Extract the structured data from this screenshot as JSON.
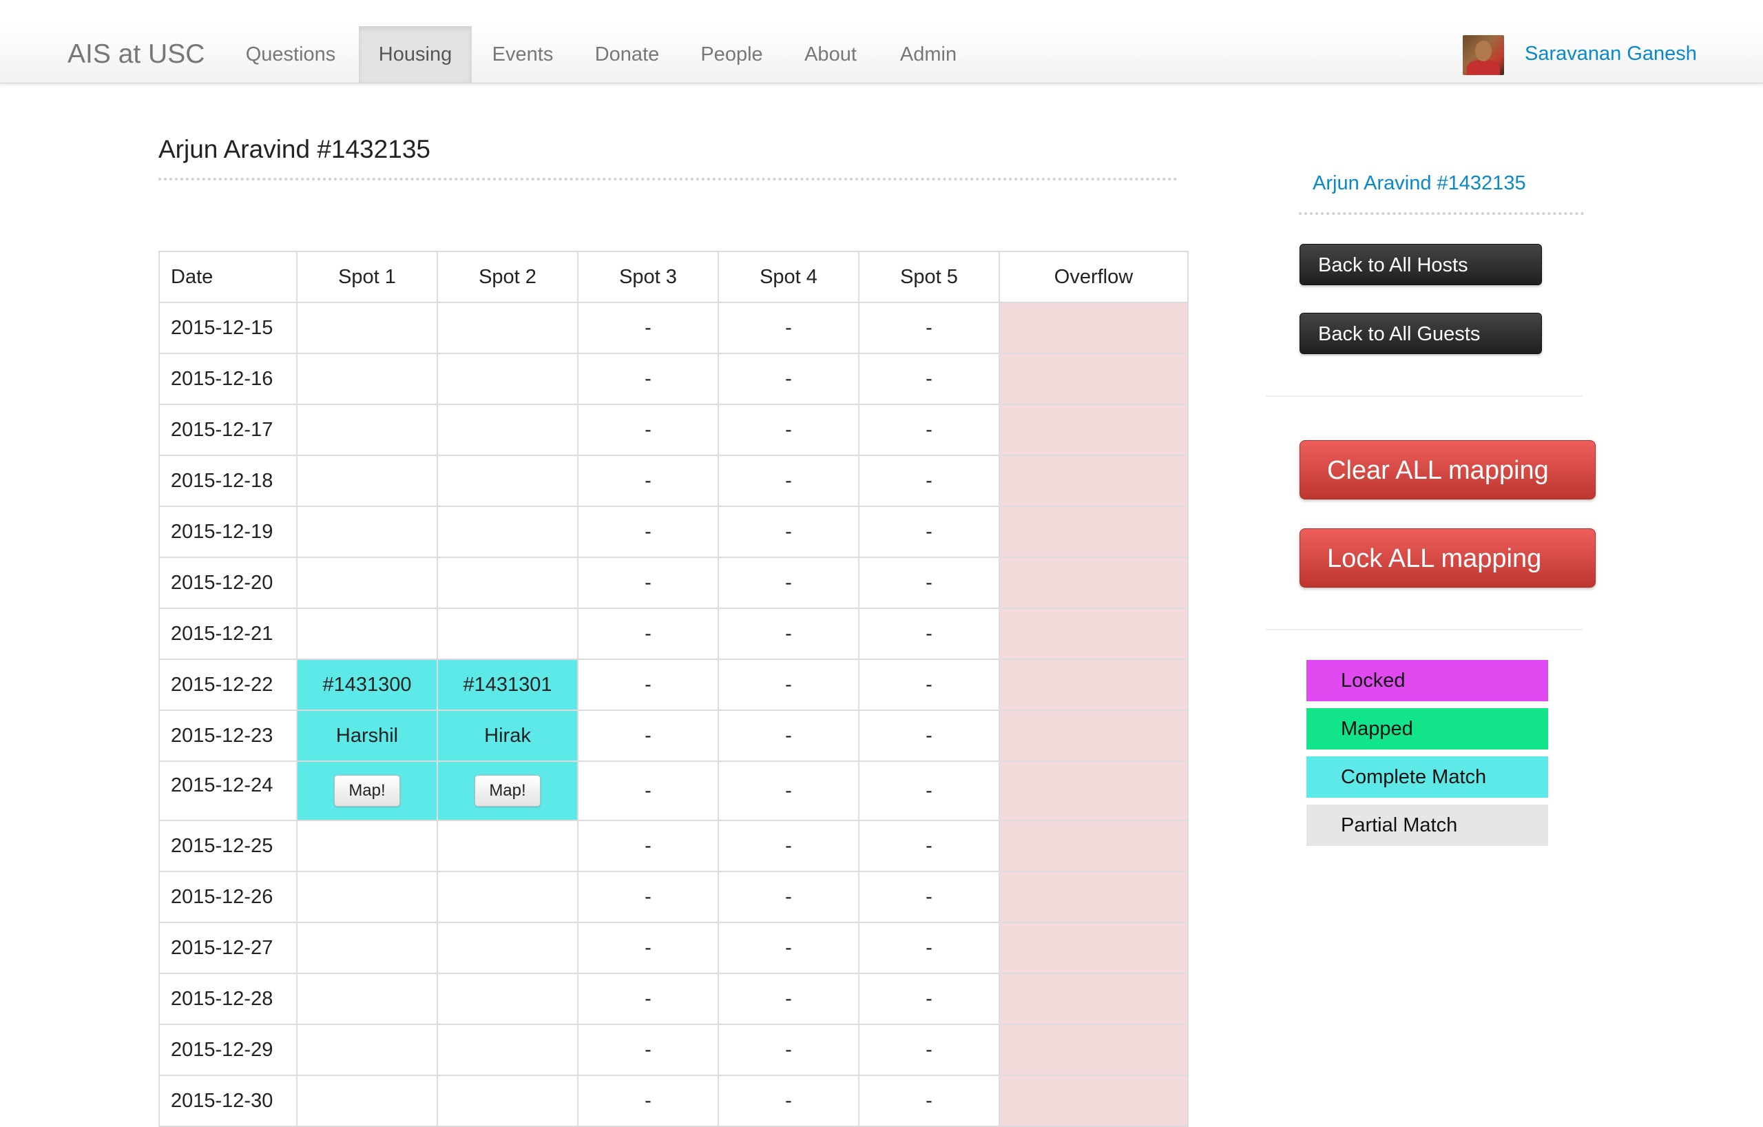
{
  "nav": {
    "brand": "AIS at USC",
    "items": [
      {
        "label": "Questions"
      },
      {
        "label": "Housing",
        "active": true
      },
      {
        "label": "Events"
      },
      {
        "label": "Donate"
      },
      {
        "label": "People"
      },
      {
        "label": "About"
      },
      {
        "label": "Admin"
      }
    ],
    "user_name": "Saravanan Ganesh"
  },
  "main": {
    "title": "Arjun Aravind #1432135",
    "table": {
      "headers": [
        "Date",
        "Spot 1",
        "Spot 2",
        "Spot 3",
        "Spot 4",
        "Spot 5",
        "Overflow"
      ],
      "rows": [
        {
          "date": "2015-12-15",
          "spot1": "",
          "spot2": "",
          "spot3": "-",
          "spot4": "-",
          "spot5": "-"
        },
        {
          "date": "2015-12-16",
          "spot1": "",
          "spot2": "",
          "spot3": "-",
          "spot4": "-",
          "spot5": "-"
        },
        {
          "date": "2015-12-17",
          "spot1": "",
          "spot2": "",
          "spot3": "-",
          "spot4": "-",
          "spot5": "-"
        },
        {
          "date": "2015-12-18",
          "spot1": "",
          "spot2": "",
          "spot3": "-",
          "spot4": "-",
          "spot5": "-"
        },
        {
          "date": "2015-12-19",
          "spot1": "",
          "spot2": "",
          "spot3": "-",
          "spot4": "-",
          "spot5": "-"
        },
        {
          "date": "2015-12-20",
          "spot1": "",
          "spot2": "",
          "spot3": "-",
          "spot4": "-",
          "spot5": "-"
        },
        {
          "date": "2015-12-21",
          "spot1": "",
          "spot2": "",
          "spot3": "-",
          "spot4": "-",
          "spot5": "-"
        },
        {
          "date": "2015-12-22",
          "spot1": "#1431300",
          "spot2": "#1431301",
          "spot3": "-",
          "spot4": "-",
          "spot5": "-"
        },
        {
          "date": "2015-12-23",
          "spot1": "Harshil",
          "spot2": "Hirak",
          "spot3": "-",
          "spot4": "-",
          "spot5": "-"
        },
        {
          "date": "2015-12-24",
          "spot1": "Map!",
          "spot2": "Map!",
          "spot3": "-",
          "spot4": "-",
          "spot5": "-"
        },
        {
          "date": "2015-12-25",
          "spot1": "",
          "spot2": "",
          "spot3": "-",
          "spot4": "-",
          "spot5": "-"
        },
        {
          "date": "2015-12-26",
          "spot1": "",
          "spot2": "",
          "spot3": "-",
          "spot4": "-",
          "spot5": "-"
        },
        {
          "date": "2015-12-27",
          "spot1": "",
          "spot2": "",
          "spot3": "-",
          "spot4": "-",
          "spot5": "-"
        },
        {
          "date": "2015-12-28",
          "spot1": "",
          "spot2": "",
          "spot3": "-",
          "spot4": "-",
          "spot5": "-"
        },
        {
          "date": "2015-12-29",
          "spot1": "",
          "spot2": "",
          "spot3": "-",
          "spot4": "-",
          "spot5": "-"
        },
        {
          "date": "2015-12-30",
          "spot1": "",
          "spot2": "",
          "spot3": "-",
          "spot4": "-",
          "spot5": "-"
        }
      ]
    }
  },
  "sidebar": {
    "link": "Arjun Aravind #1432135",
    "back_hosts": "Back to All Hosts",
    "back_guests": "Back to All Guests",
    "clear_all": "Clear ALL mapping",
    "lock_all": "Lock ALL mapping",
    "legend": [
      {
        "label": "Locked",
        "color": "#e04af0"
      },
      {
        "label": "Mapped",
        "color": "#12e48a"
      },
      {
        "label": "Complete Match",
        "color": "#5ee9e9"
      },
      {
        "label": "Partial Match",
        "color": "#e6e6e6"
      }
    ]
  },
  "colors": {
    "match_cell": "#5ee9e9",
    "overflow_cell": "#f2d9da",
    "danger": "#da4f49",
    "link": "#0a88cc"
  },
  "icons": {
    "avatar": "user-avatar-photo"
  }
}
